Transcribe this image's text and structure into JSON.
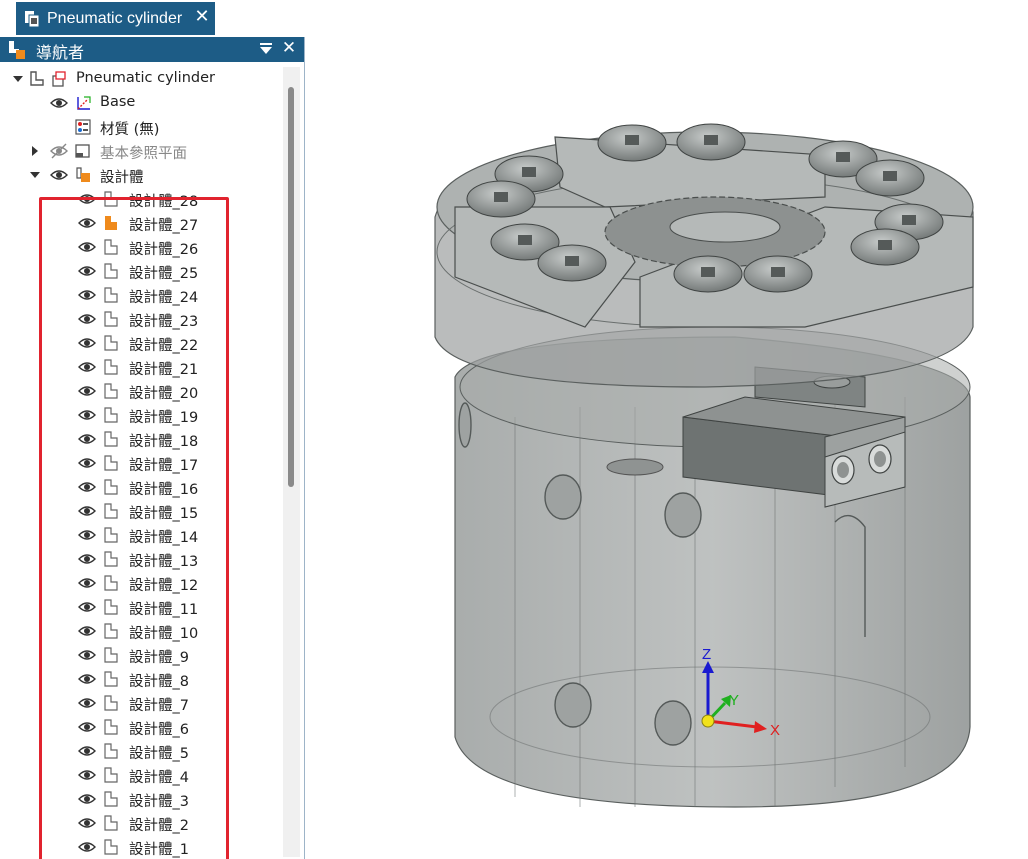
{
  "document_tab": {
    "title": "Pneumatic cylinder",
    "close_glyph": "✕",
    "icon": "part-document-icon"
  },
  "navigator": {
    "title": "導航者",
    "pin_icon": "dropdown-pin-icon",
    "close_glyph": "✕",
    "root": {
      "label": "Pneumatic cylinder",
      "icon": "part-icon"
    },
    "base": {
      "label": "Base",
      "icon": "coordinate-system-icon"
    },
    "material": {
      "label": "材質 (無)",
      "icon": "material-icon"
    },
    "ref_planes": {
      "label": "基本參照平面",
      "icon": "reference-plane-icon"
    },
    "bodies_group": {
      "label": "設計體",
      "icon": "design-bodies-icon"
    },
    "bodies": [
      {
        "label": "設計體_28",
        "active": false
      },
      {
        "label": "設計體_27",
        "active": true
      },
      {
        "label": "設計體_26",
        "active": false
      },
      {
        "label": "設計體_25",
        "active": false
      },
      {
        "label": "設計體_24",
        "active": false
      },
      {
        "label": "設計體_23",
        "active": false
      },
      {
        "label": "設計體_22",
        "active": false
      },
      {
        "label": "設計體_21",
        "active": false
      },
      {
        "label": "設計體_20",
        "active": false
      },
      {
        "label": "設計體_19",
        "active": false
      },
      {
        "label": "設計體_18",
        "active": false
      },
      {
        "label": "設計體_17",
        "active": false
      },
      {
        "label": "設計體_16",
        "active": false
      },
      {
        "label": "設計體_15",
        "active": false
      },
      {
        "label": "設計體_14",
        "active": false
      },
      {
        "label": "設計體_13",
        "active": false
      },
      {
        "label": "設計體_12",
        "active": false
      },
      {
        "label": "設計體_11",
        "active": false
      },
      {
        "label": "設計體_10",
        "active": false
      },
      {
        "label": "設計體_9",
        "active": false
      },
      {
        "label": "設計體_8",
        "active": false
      },
      {
        "label": "設計體_7",
        "active": false
      },
      {
        "label": "設計體_6",
        "active": false
      },
      {
        "label": "設計體_5",
        "active": false
      },
      {
        "label": "設計體_4",
        "active": false
      },
      {
        "label": "設計體_3",
        "active": false
      },
      {
        "label": "設計體_2",
        "active": false
      },
      {
        "label": "設計體_1",
        "active": false
      }
    ]
  },
  "viewport": {
    "model": "pneumatic-gripper-model",
    "axis_triad": {
      "z_label": "Z",
      "y_label": "Y",
      "x_label": "X"
    }
  },
  "colors": {
    "tab_bg": "#1d5c86",
    "highlight": "#e1232e",
    "active_body": "#ef8a1c",
    "axis_x": "#e02020",
    "axis_y": "#20b020",
    "axis_z": "#1a1ad0"
  }
}
